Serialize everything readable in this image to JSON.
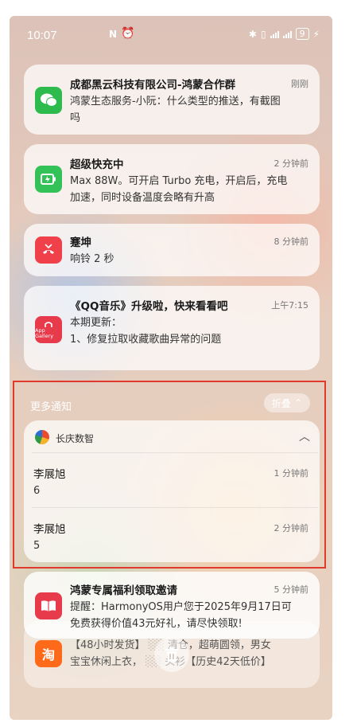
{
  "status_bar": {
    "time": "10:07",
    "battery": "9"
  },
  "notifications": [
    {
      "app_icon": "wechat-icon",
      "title": "成都黑云科技有限公司-鸿蒙合作群",
      "time": "刚刚",
      "body_lines": [
        "鸿蒙生态服务-小阮：什么类型的推送，有截图",
        "吗"
      ],
      "color": "#2dbb4e"
    },
    {
      "app_icon": "charging-icon",
      "title": "超级快充中",
      "time": "2 分钟前",
      "body_lines": [
        "Max 88W。可开启 Turbo 充电，开启后，充电",
        "加速，同时设备温度会略有升高"
      ],
      "color": "#33c257"
    },
    {
      "app_icon": "missed-call-icon",
      "title": "蹇坤",
      "time": "8 分钟前",
      "body_lines": [
        "响铃 2 秒"
      ],
      "color": "#f0404a"
    },
    {
      "app_icon": "app-gallery-icon",
      "icon_text": "App Gallery",
      "title": "《QQ音乐》升级啦，快来看看吧",
      "time": "上午7:15",
      "body_lines": [
        "本期更新：",
        "1、修复拉取收藏歌曲异常的问题"
      ],
      "color": "#e73a4a"
    }
  ],
  "more_group": {
    "header": "更多通知",
    "fold_label": "折叠",
    "app_name": "长庆数智",
    "items": [
      {
        "title": "李展旭",
        "time": "1 分钟前",
        "body": "6"
      },
      {
        "title": "李展旭",
        "time": "2 分钟前",
        "body": "5"
      }
    ]
  },
  "bottom_notification": {
    "title": "鸿蒙专属福利领取邀请",
    "time": "5 分钟前",
    "body_lines": [
      "提醒：HarmonyOS用户您于2025年9月17日可",
      "免费获得价值43元好礼，请尽快领取!"
    ],
    "color": "#e73a4a"
  },
  "partial_notification": {
    "icon_text": "淘",
    "body_lines": [
      "【48小时发货】",
      "清仓，超萌圆领，男女",
      "宝宝休闲上衣，",
      "头衫【历史42天低价】"
    ]
  }
}
